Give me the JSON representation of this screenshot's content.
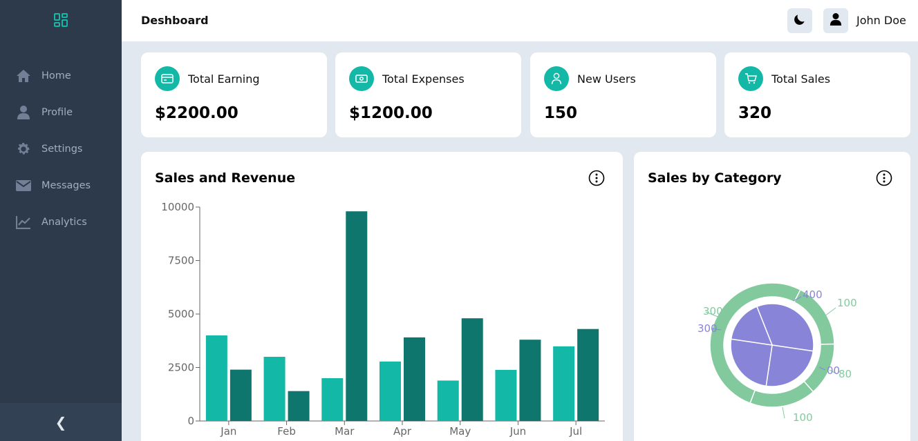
{
  "sidebar": {
    "logo_icon": "grid-icon",
    "items": [
      {
        "label": "Home",
        "icon": "home-icon"
      },
      {
        "label": "Profile",
        "icon": "user-icon"
      },
      {
        "label": "Settings",
        "icon": "gear-icon"
      },
      {
        "label": "Messages",
        "icon": "envelope-icon"
      },
      {
        "label": "Analytics",
        "icon": "chart-line-icon"
      }
    ],
    "collapse_label": "❮"
  },
  "header": {
    "title": "Deshboard",
    "theme_icon": "moon-icon",
    "user_name": "John Doe"
  },
  "cards": [
    {
      "title": "Total Earning",
      "value": "$2200.00",
      "icon": "credit-card-icon"
    },
    {
      "title": "Total Expenses",
      "value": "$1200.00",
      "icon": "money-icon"
    },
    {
      "title": "New Users",
      "value": "150",
      "icon": "user-icon"
    },
    {
      "title": "Total Sales",
      "value": "320",
      "icon": "cart-icon"
    }
  ],
  "panels": {
    "sales_revenue_title": "Sales and Revenue",
    "category_title": "Sales by Category"
  },
  "colors": {
    "accent": "#14b8a6",
    "accent_dark": "#0f766e",
    "sidebar_bg": "#2d3a4b",
    "pie_inner": "#8884d8",
    "pie_outer": "#82ca9d"
  },
  "chart_data": [
    {
      "type": "bar",
      "title": "Sales and Revenue",
      "categories": [
        "Jan",
        "Feb",
        "Mar",
        "Apr",
        "May",
        "Jun",
        "Jul"
      ],
      "series": [
        {
          "values": [
            4000,
            3000,
            2000,
            2780,
            1890,
            2390,
            3490
          ],
          "color": "#14b8a6"
        },
        {
          "values": [
            2400,
            1398,
            9800,
            3908,
            4800,
            3800,
            4300
          ],
          "color": "#0f766e"
        }
      ],
      "yticks": [
        "0",
        "2500",
        "5000",
        "7500",
        "10000"
      ],
      "ylim": [
        0,
        10000
      ],
      "grid": false
    },
    {
      "type": "pie",
      "title": "Sales by Category",
      "inner": {
        "values": [
          400,
          300,
          300,
          200
        ],
        "visible_labels": [
          "400",
          "300"
        ],
        "color": "#8884d8"
      },
      "outer": {
        "values": [
          100,
          80,
          100,
          300
        ],
        "visible_labels": [
          "100",
          "80",
          "100",
          "300"
        ],
        "color": "#82ca9d"
      },
      "partial_labels": [
        "00"
      ]
    }
  ]
}
